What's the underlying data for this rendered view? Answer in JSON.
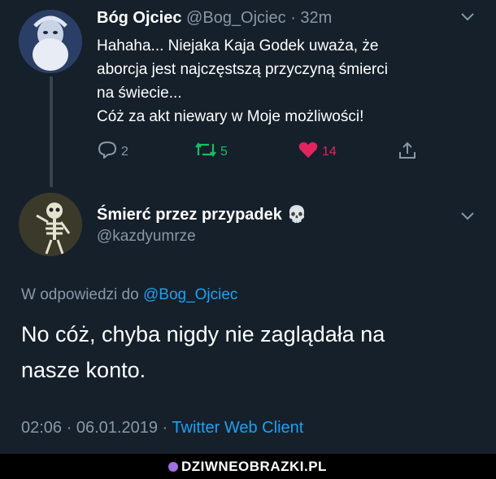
{
  "tweet1": {
    "author_name": "Bóg Ojciec",
    "author_handle": "@Bog_Ojciec",
    "separator": "·",
    "time": "32m",
    "text_lines": [
      "Hahaha... Niejaka Kaja Godek uważa, że",
      "aborcja jest najczęstszą przyczyną śmierci",
      "na świecie...",
      "Cóż za akt niewary w Moje możliwości!"
    ],
    "reply_count": "2",
    "retweet_count": "5",
    "like_count": "14"
  },
  "tweet2": {
    "author_name": "Śmierć przez przypadek",
    "author_emoji": "💀",
    "author_handle": "@kazdyumrze",
    "reply_prefix": "W odpowiedzi do",
    "reply_mention": "@Bog_Ojciec",
    "text_lines": [
      "No cóż, chyba nigdy nie zaglądała na",
      "nasze konto."
    ],
    "time": "02:06",
    "date": "06.01.2019",
    "separator": "·",
    "client": "Twitter Web Client"
  },
  "watermark": {
    "text": "DZIWNEOBRAZKI.PL"
  },
  "colors": {
    "background": "#15202b",
    "link": "#1da1f2",
    "retweet": "#17bf63",
    "like": "#e0245e",
    "muted": "#8899a6"
  },
  "icons": [
    "reply-icon",
    "retweet-icon",
    "heart-icon",
    "share-icon",
    "chevron-down-icon",
    "skull-emoji"
  ]
}
